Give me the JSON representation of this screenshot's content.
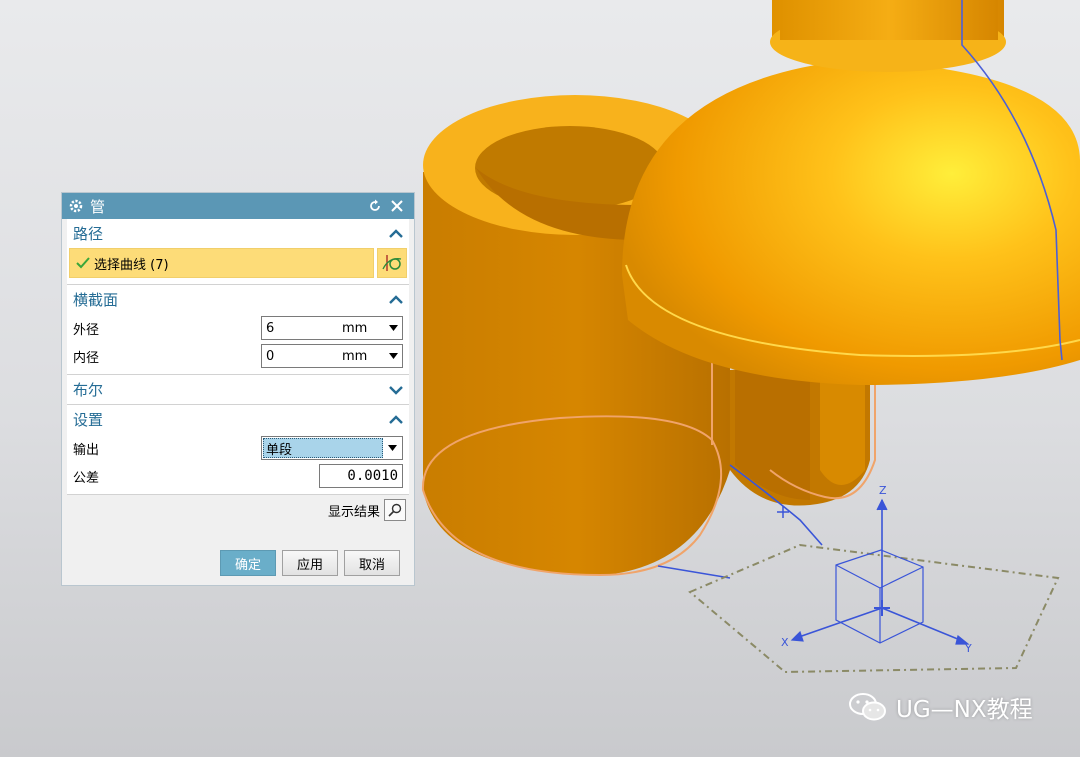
{
  "dialog": {
    "title": "管",
    "sections": {
      "path": {
        "title": "路径",
        "selection_label": "选择曲线 (7)"
      },
      "cross_section": {
        "title": "横截面",
        "outer_label": "外径",
        "outer_value": "6",
        "outer_unit": "mm",
        "inner_label": "内径",
        "inner_value": "0",
        "inner_unit": "mm"
      },
      "boolean": {
        "title": "布尔"
      },
      "settings": {
        "title": "设置",
        "output_label": "输出",
        "output_value": "单段",
        "tolerance_label": "公差",
        "tolerance_value": "0.0010"
      }
    },
    "show_result_label": "显示结果",
    "buttons": {
      "ok": "确定",
      "apply": "应用",
      "cancel": "取消"
    }
  },
  "viewport": {
    "axis_labels": {
      "x": "X",
      "y": "Y",
      "z": "Z"
    },
    "colors": {
      "model": "#f5a300",
      "curve": "#3a55d8",
      "edge": "#f2a06a"
    }
  },
  "watermark": {
    "text": "UG—NX教程"
  }
}
